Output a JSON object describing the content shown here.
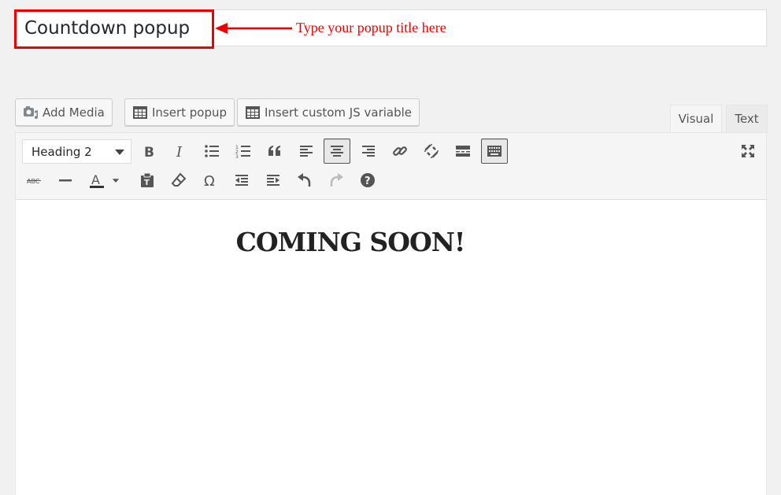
{
  "title": {
    "value": "Countdown popup",
    "annotation": "Type your popup title here"
  },
  "media_buttons": [
    {
      "label": "Add Media",
      "icon": "camera-music-icon"
    },
    {
      "label": "Insert popup",
      "icon": "table-icon"
    },
    {
      "label": "Insert custom JS variable",
      "icon": "table-icon"
    }
  ],
  "tabs": {
    "visual": "Visual",
    "text": "Text"
  },
  "toolbar": {
    "format_value": "Heading 2"
  },
  "content": {
    "heading": "COMING SOON!"
  },
  "colors": {
    "annotation": "#ee0000",
    "text_color_bar": "#333333"
  }
}
